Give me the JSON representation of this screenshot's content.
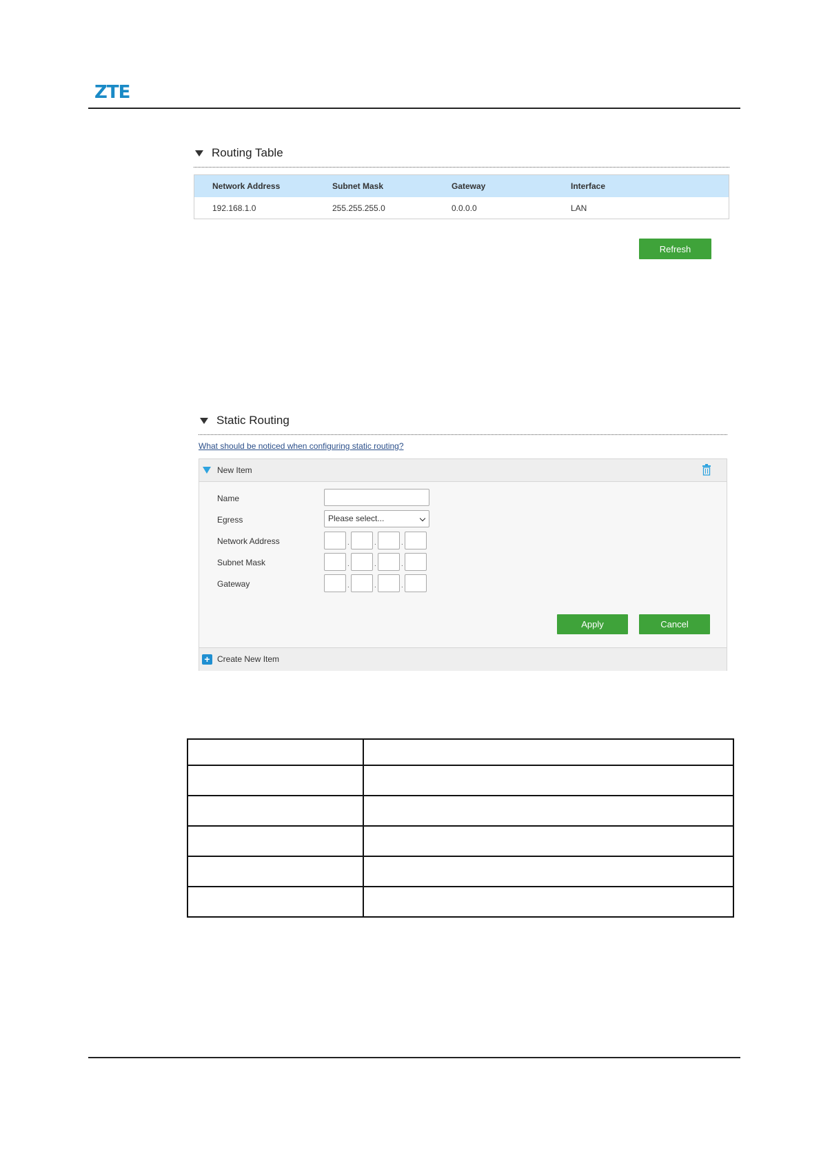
{
  "brand": {
    "logo_text": "ZTE"
  },
  "routing_table": {
    "title": "Routing Table",
    "columns": [
      "Network Address",
      "Subnet Mask",
      "Gateway",
      "Interface"
    ],
    "rows": [
      [
        "192.168.1.0",
        "255.255.255.0",
        "0.0.0.0",
        "LAN"
      ]
    ],
    "refresh_label": "Refresh"
  },
  "static_routing": {
    "title": "Static Routing",
    "help_link": "What should be noticed when configuring static routing?",
    "item_title": "New Item",
    "fields": {
      "name": "Name",
      "egress": "Egress",
      "network_address": "Network Address",
      "subnet_mask": "Subnet Mask",
      "gateway": "Gateway"
    },
    "egress_selected": "Please select...",
    "apply_label": "Apply",
    "cancel_label": "Cancel",
    "create_label": "Create New Item"
  },
  "colors": {
    "brand_blue": "#1a8ac6",
    "table_header": "#c9e6fb",
    "button_green": "#3fa33a",
    "accent_blue": "#2ea3df"
  }
}
